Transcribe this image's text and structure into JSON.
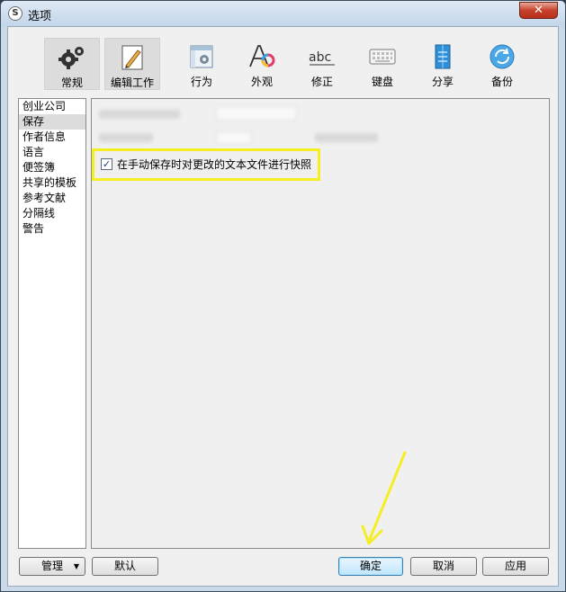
{
  "window": {
    "title": "选项",
    "close_label": "✕",
    "app_icon_letter": "S"
  },
  "toolbar": {
    "items": [
      {
        "label": "常规",
        "icon": "gears-icon",
        "active": true
      },
      {
        "label": "编辑工作",
        "icon": "pen-edit-icon",
        "active": true
      },
      {
        "label": "行为",
        "icon": "window-gear-icon",
        "active": false
      },
      {
        "label": "外观",
        "icon": "font-color-icon",
        "active": false
      },
      {
        "label": "修正",
        "icon": "spellcheck-abc-icon",
        "active": false
      },
      {
        "label": "键盘",
        "icon": "keyboard-icon",
        "active": false
      },
      {
        "label": "分享",
        "icon": "share-book-icon",
        "active": false
      },
      {
        "label": "备份",
        "icon": "backup-sync-icon",
        "active": false
      }
    ]
  },
  "sidebar": {
    "items": [
      "创业公司",
      "保存",
      "作者信息",
      "语言",
      "便签簿",
      "共享的模板",
      "参考文献",
      "分隔线",
      "警告"
    ],
    "selected_index": 1
  },
  "content": {
    "snapshot_checkbox": {
      "label": "在手动保存时对更改的文本文件进行快照",
      "checked": true,
      "mark": "✓"
    }
  },
  "buttons": {
    "manage": "管理",
    "default": "默认",
    "ok": "确定",
    "cancel": "取消",
    "apply": "应用"
  },
  "colors": {
    "highlight": "#f5ee23",
    "arrow": "#f5ee23"
  }
}
